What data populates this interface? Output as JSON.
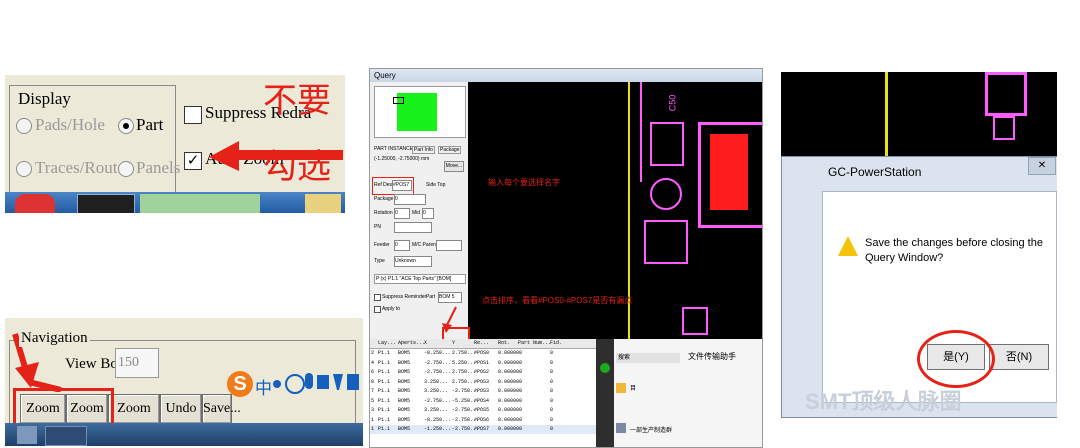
{
  "display_panel": {
    "legend": "Display",
    "options": {
      "pads_hole": "Pads/Hole",
      "part": "Part",
      "traces_rout": "Traces/Rout",
      "panels": "Panels",
      "suppress": "Suppress Redra",
      "auto_zoom": "Auto Zoom"
    },
    "annotation_top": "不要",
    "annotation_bottom": "勾选"
  },
  "navigation_panel": {
    "legend": "Navigation",
    "view_border_label": "View Border",
    "view_border_value": "150",
    "buttons": {
      "zoom_out": "Zoom Out",
      "zoom_in": "Zoom In",
      "zoom_extents": "Zoom Extents",
      "undo_sort": "Undo Sort",
      "save": "Save..."
    },
    "ime_logo": "S",
    "ime_char": "中"
  },
  "query_panel": {
    "title": "Query",
    "part_instance": "PART INSTANCE",
    "tabs": [
      "Part Info",
      "Package"
    ],
    "coords": "(-1.25000, -2.75000) mm",
    "move_button": "Move...",
    "ref_des_label": "Ref Des",
    "ref_des_value": "#POS7",
    "side_label": "Side Top",
    "note_name": "输入每个要选择名字",
    "package_label": "Package",
    "package_value": "0",
    "rotation_label": "Rotation",
    "rotation_value": "0",
    "mid_label": "Mid",
    "mid_value": "0",
    "pn_label": "PN",
    "feeder_label": "Feeder",
    "feeder_value": "0",
    "mfc_label": "M/C Parent",
    "type_label": "Type",
    "type_value": "Unknown",
    "part_ref": "P (x) P1.1 \"ACE Top Parts\" [BOM]",
    "suppress_reminder": "Suppress Reminder:",
    "part_label": "Part",
    "part_value": "BOM 5",
    "apply_to": "Apply to",
    "note_sort": "点击排序，看看#POS0-#POS7是否有漏点",
    "silk_label": "C50",
    "table_headers": [
      "Lay...",
      "Aperts...",
      "X",
      "Y",
      "Re...",
      "Rot.",
      "Part Num...",
      "Fid."
    ],
    "table_rows": [
      {
        "no": "2",
        "layer": "P1.1",
        "aperture": "BOM5",
        "x": "-8.250...",
        "y": "2.750...",
        "ref": "#POS0",
        "rot": "0.000000",
        "fid": "0"
      },
      {
        "no": "4",
        "layer": "P1.1",
        "aperture": "BOM5",
        "x": "-2.750...",
        "y": "5.250...",
        "ref": "#POS1",
        "rot": "0.000000",
        "fid": "0"
      },
      {
        "no": "6",
        "layer": "P1.1",
        "aperture": "BOM5",
        "x": "-2.750...",
        "y": "2.750...",
        "ref": "#POS2",
        "rot": "0.000000",
        "fid": "0"
      },
      {
        "no": "8",
        "layer": "P1.1",
        "aperture": "BOM5",
        "x": "3.250...",
        "y": "2.750...",
        "ref": "#POS3",
        "rot": "0.000000",
        "fid": "0"
      },
      {
        "no": "7",
        "layer": "P1.1",
        "aperture": "BOM5",
        "x": "3.250...",
        "y": "-2.750...",
        "ref": "#POS3",
        "rot": "0.000000",
        "fid": "0"
      },
      {
        "no": "5",
        "layer": "P1.1",
        "aperture": "BOM5",
        "x": "-2.750...",
        "y": "-5.250...",
        "ref": "#POS4",
        "rot": "0.000000",
        "fid": "0"
      },
      {
        "no": "3",
        "layer": "P1.1",
        "aperture": "BOM5",
        "x": "3.250...",
        "y": "-2.750...",
        "ref": "#POS5",
        "rot": "0.000000",
        "fid": "0"
      },
      {
        "no": "1",
        "layer": "P1.1",
        "aperture": "BOM5",
        "x": "-8.250...",
        "y": "-2.750...",
        "ref": "#POS6",
        "rot": "0.000000",
        "fid": "0"
      },
      {
        "no": "1",
        "layer": "P1.1",
        "aperture": "BOM5",
        "x": "-1.250...",
        "y": "-2.750...",
        "ref": "#POS7",
        "rot": "0.000000",
        "fid": "0"
      }
    ],
    "chat_search": "搜索",
    "chat_title": "文件传输助手",
    "chat_item1": "目",
    "chat_item2": "一部生产制造群"
  },
  "dialog_panel": {
    "title": "GC-PowerStation",
    "message": "Save the changes before closing the Query Window?",
    "yes_button": "是(Y)",
    "no_button": "否(N)",
    "close_glyph": "✕"
  },
  "watermark": "SMT顶级人脉圈",
  "colors": {
    "annotation_red": "#e52218",
    "pcb_magenta": "#ff5cff",
    "pcb_red": "#ff1c1c",
    "pcb_yellow": "#e9e11a",
    "query_green": "#17f21b"
  }
}
